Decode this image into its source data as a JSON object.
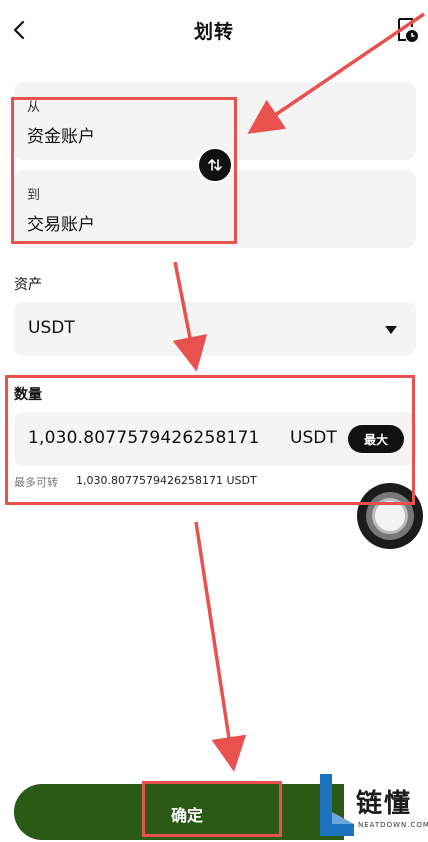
{
  "header": {
    "title": "划转",
    "back_icon": "chevron-left-icon",
    "history_icon": "clock-document-icon"
  },
  "transfer": {
    "from_caption": "从",
    "from_account": "资金账户",
    "to_caption": "到",
    "to_account": "交易账户",
    "swap_icon": "swap-vertical-icon"
  },
  "asset": {
    "label": "资产",
    "selected": "USDT"
  },
  "amount": {
    "label": "数量",
    "value": "1,030.8077579426258171",
    "unit": "USDT",
    "max_label": "最大",
    "available_label": "最多可转",
    "available_value": "1,030.8077579426258171 USDT"
  },
  "confirm": {
    "label": "确定"
  },
  "watermark": {
    "text": "链懂",
    "sub": "NEATDOWN.COM"
  },
  "colors": {
    "confirm_bg": "#2b5a17",
    "annotation": "#e8514d",
    "card_bg": "#f4f4f4"
  }
}
